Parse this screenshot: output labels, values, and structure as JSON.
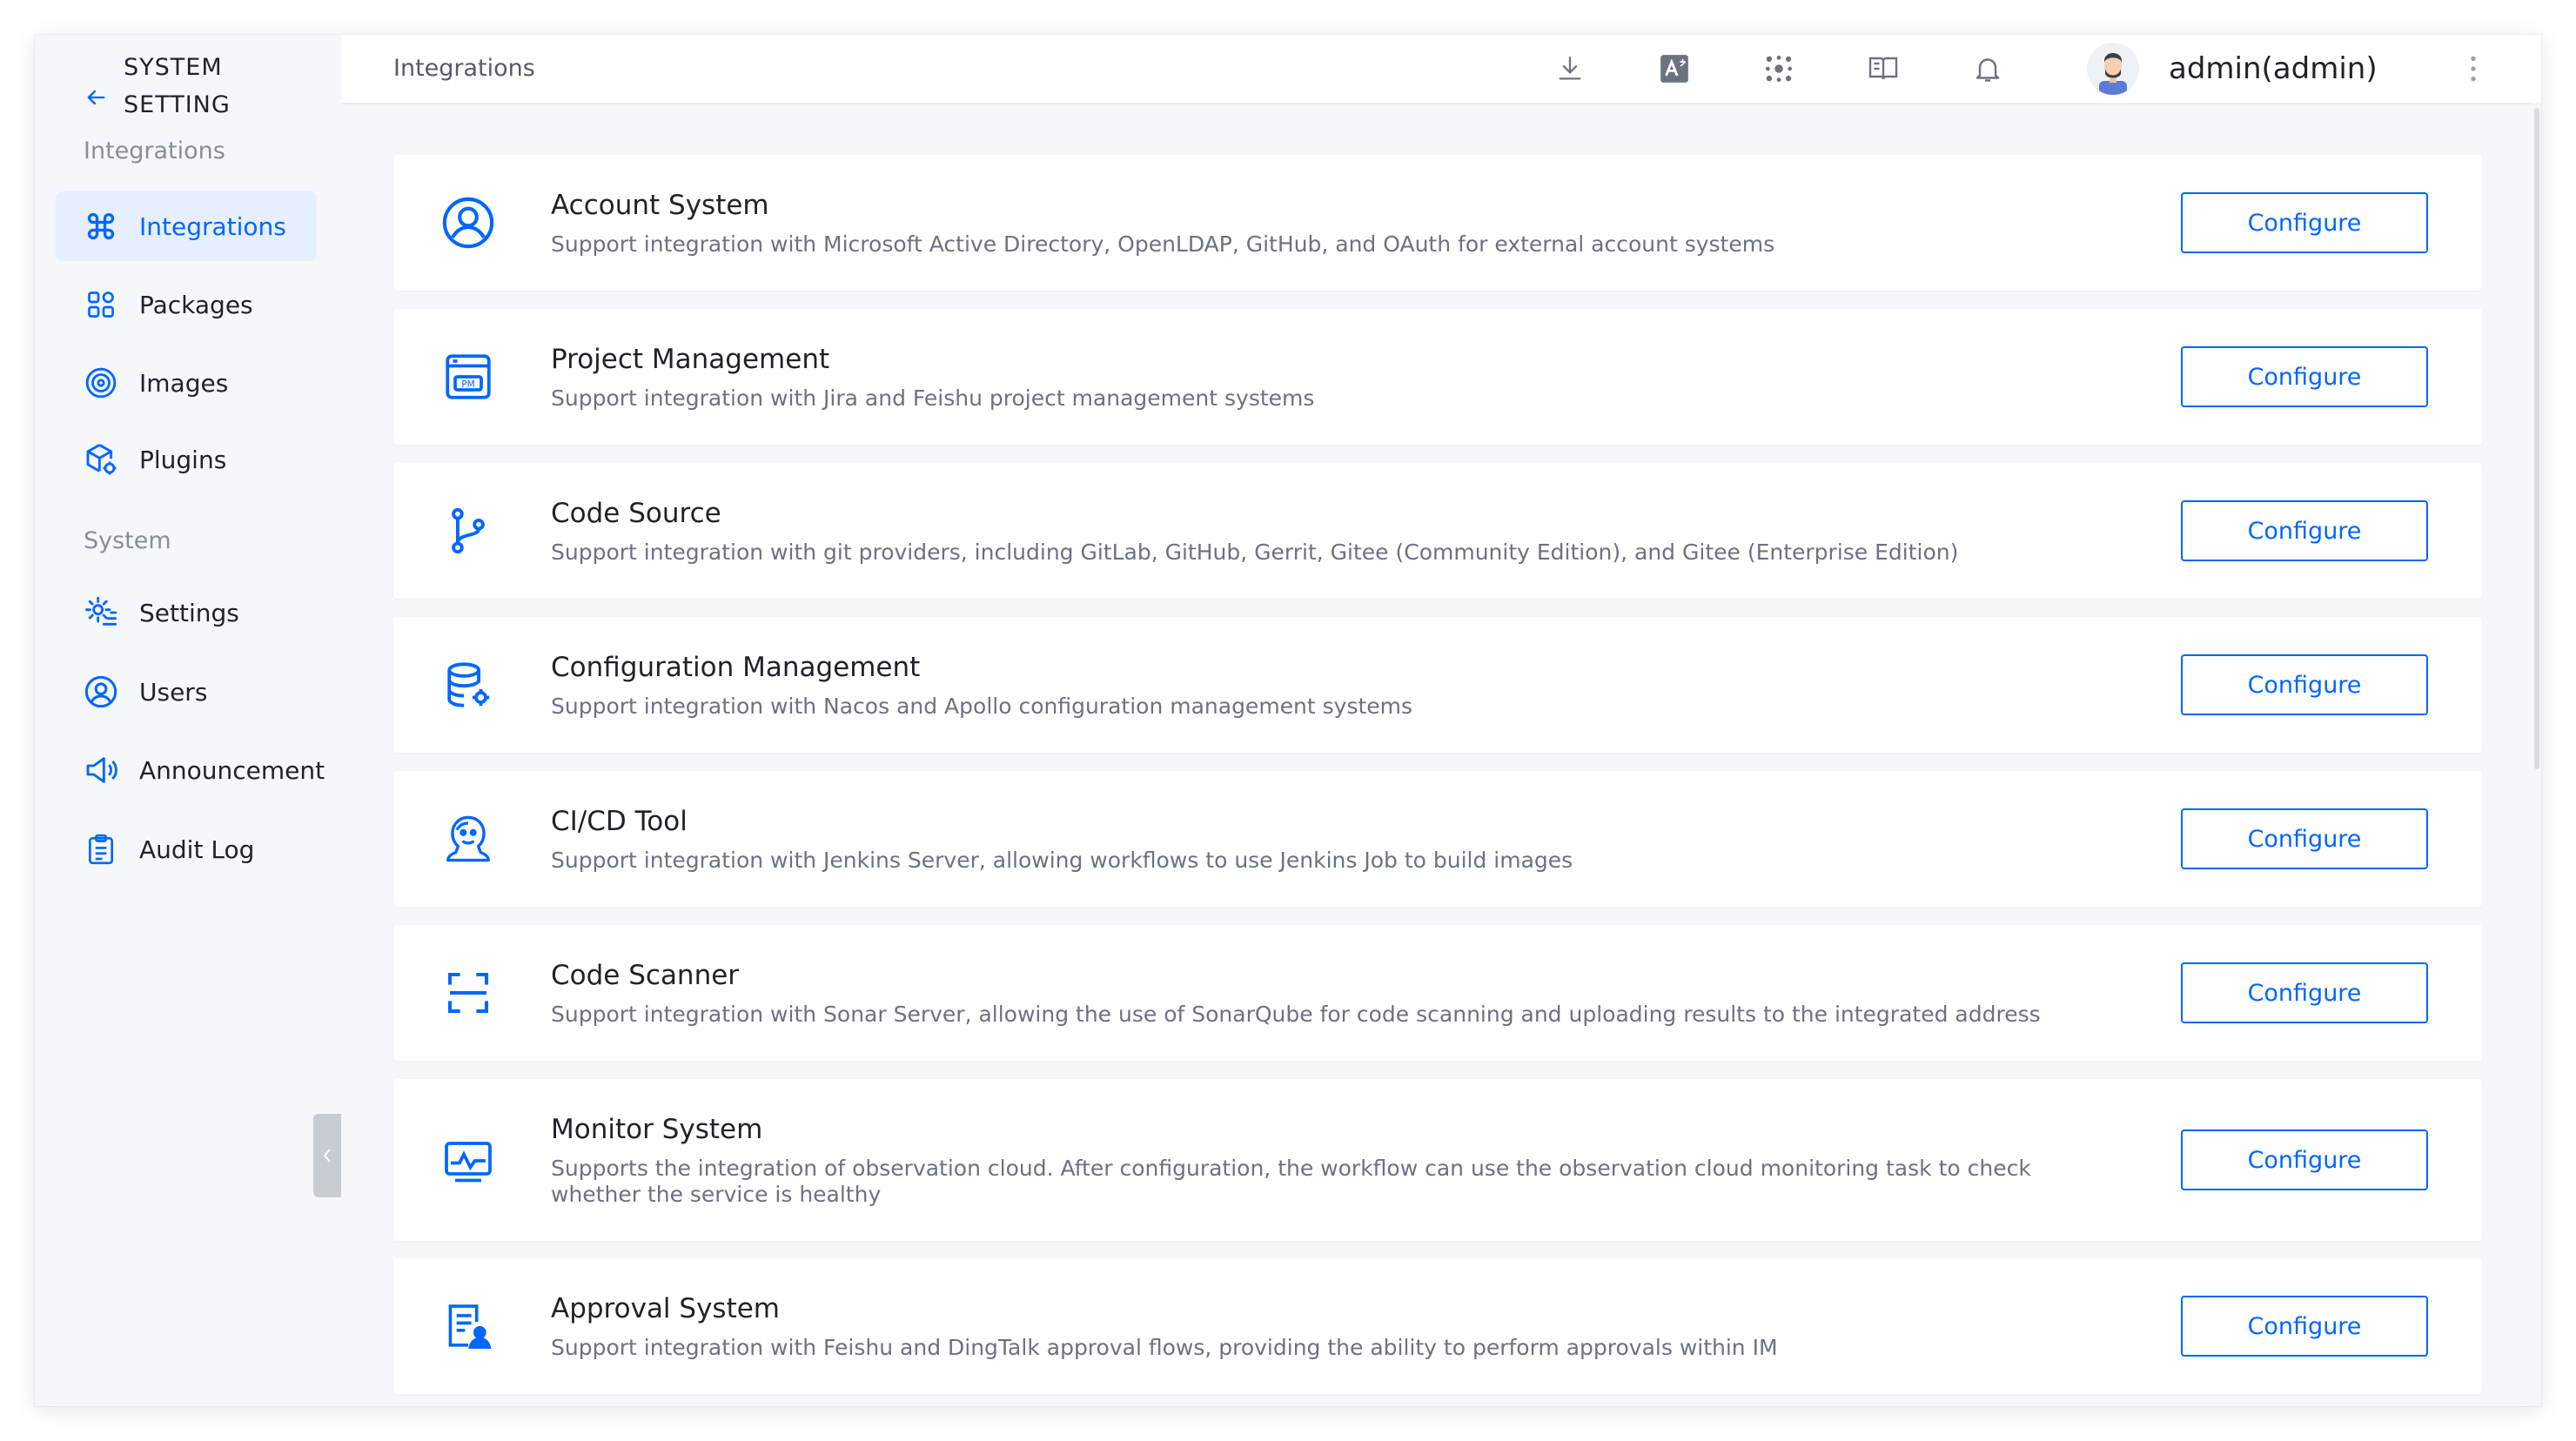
{
  "sidebar": {
    "title_line1": "SYSTEM",
    "title_line2": "SETTING",
    "section_integrations": "Integrations",
    "section_system": "System",
    "items_integrations": [
      {
        "label": "Integrations",
        "icon": "command-icon",
        "active": true
      },
      {
        "label": "Packages",
        "icon": "grid-icon",
        "active": false
      },
      {
        "label": "Images",
        "icon": "disc-icon",
        "active": false
      },
      {
        "label": "Plugins",
        "icon": "cube-gear-icon",
        "active": false
      }
    ],
    "items_system": [
      {
        "label": "Settings",
        "icon": "settings-icon"
      },
      {
        "label": "Users",
        "icon": "user-circle-icon"
      },
      {
        "label": "Announcement",
        "icon": "megaphone-icon"
      },
      {
        "label": "Audit Log",
        "icon": "clipboard-icon"
      }
    ]
  },
  "topbar": {
    "breadcrumb": "Integrations",
    "username": "admin(admin)",
    "icons": [
      "download-icon",
      "translate-icon",
      "apps-icon",
      "book-icon",
      "bell-icon",
      "more-icon"
    ]
  },
  "cards": [
    {
      "title": "Account System",
      "desc": "Support integration with Microsoft Active Directory, OpenLDAP, GitHub, and OAuth for external account systems",
      "button": "Configure",
      "icon": "account-icon"
    },
    {
      "title": "Project Management",
      "desc": "Support integration with Jira and Feishu project management systems",
      "button": "Configure",
      "icon": "pm-icon"
    },
    {
      "title": "Code Source",
      "desc": "Support integration with git providers, including GitLab, GitHub, Gerrit, Gitee (Community Edition), and Gitee (Enterprise Edition)",
      "button": "Configure",
      "icon": "git-branch-icon"
    },
    {
      "title": "Configuration Management",
      "desc": "Support integration with Nacos and Apollo configuration management systems",
      "button": "Configure",
      "icon": "database-gear-icon"
    },
    {
      "title": "CI/CD Tool",
      "desc": "Support integration with Jenkins Server, allowing workflows to use Jenkins Job to build images",
      "button": "Configure",
      "icon": "jenkins-icon"
    },
    {
      "title": "Code Scanner",
      "desc": "Support integration with Sonar Server, allowing the use of SonarQube for code scanning and uploading results to the integrated address",
      "button": "Configure",
      "icon": "scan-icon"
    },
    {
      "title": "Monitor System",
      "desc": "Supports the integration of observation cloud. After configuration, the workflow can use the observation cloud monitoring task to check whether the service is healthy",
      "button": "Configure",
      "icon": "monitor-icon"
    },
    {
      "title": "Approval System",
      "desc": "Support integration with Feishu and DingTalk approval flows, providing the ability to perform approvals within IM",
      "button": "Configure",
      "icon": "approval-icon"
    }
  ],
  "colors": {
    "accent": "#0066ff",
    "active_bg": "#e6efff",
    "page_bg": "#f5f7fa"
  }
}
